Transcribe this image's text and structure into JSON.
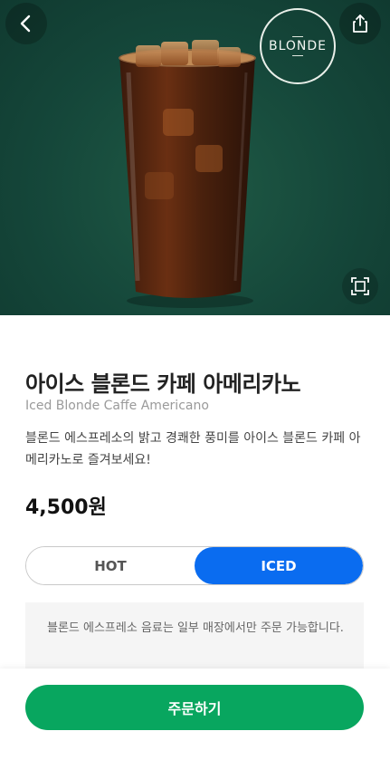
{
  "hero": {
    "badge_text": "BLONDE",
    "colors": {
      "background": "#15473a"
    }
  },
  "product": {
    "name_ko": "아이스 블론드 카페 아메리카노",
    "name_en": "Iced Blonde Caffe Americano",
    "description": "블론드 에스프레소의 밝고 경쾌한 풍미를 아이스 블론드 카페 아메리카노로 즐겨보세요!",
    "price": "4,500원"
  },
  "temperature": {
    "options": [
      "HOT",
      "ICED"
    ],
    "selected": "ICED"
  },
  "notice": "블론드 에스프레소 음료는 일부 매장에서만 주문 가능합니다.",
  "order": {
    "label": "주문하기"
  },
  "colors": {
    "accent_green": "#08a65f",
    "toggle_active": "#0a6cf0"
  },
  "icons": {
    "back": "chevron-left-icon",
    "share": "share-icon",
    "expand": "expand-icon"
  }
}
